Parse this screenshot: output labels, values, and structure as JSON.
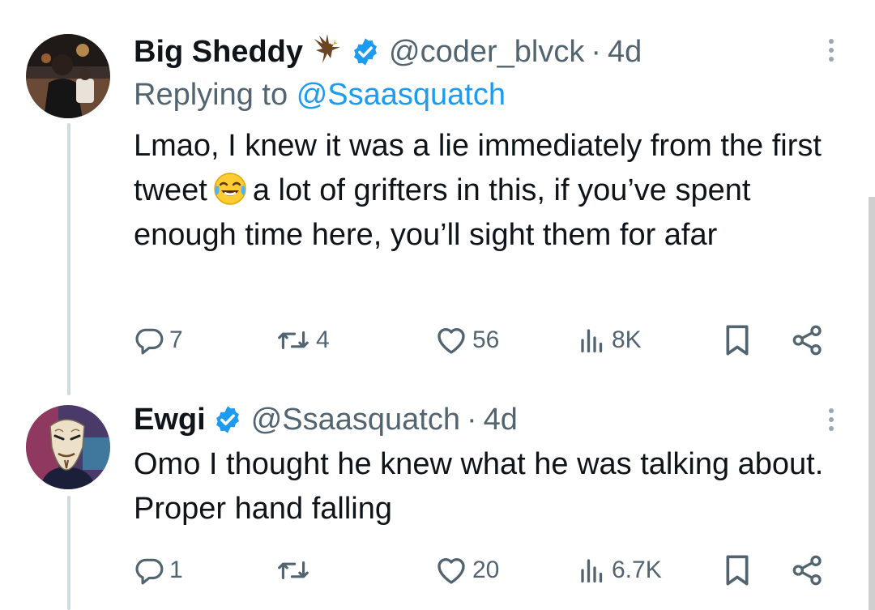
{
  "tweets": [
    {
      "name": "Big Sheddy",
      "name_emoji_icon": "eagle-icon",
      "handle": "@coder_blvck",
      "dot": "·",
      "time": "4d",
      "replying_prefix": "Replying to",
      "replying_to": "@Ssaasquatch",
      "text_before_emoji": "Lmao, I knew it was a lie immediately from the first tweet",
      "text_after_emoji": "a lot of grifters in this, if you’ve spent enough time here, you’ll sight them for afar",
      "replies": "7",
      "retweets": "4",
      "likes": "56",
      "views": "8K"
    },
    {
      "name": "Ewgi",
      "handle": "@Ssaasquatch",
      "dot": "·",
      "time": "4d",
      "text": "Omo I thought he knew what he was talking about.  Proper hand falling",
      "replies": "1",
      "retweets": "",
      "likes": "20",
      "views": "6.7K"
    }
  ],
  "colors": {
    "accent": "#1d9bf0",
    "muted": "#536471",
    "text": "#0f1419",
    "thread_line": "#cfd9de"
  }
}
